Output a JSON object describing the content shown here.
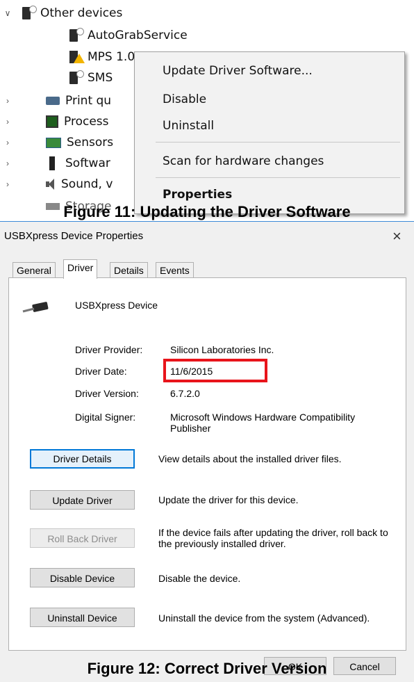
{
  "tree": {
    "rows": [
      {
        "label": "Other devices",
        "expanded": true
      },
      {
        "label": "AutoGrabService"
      },
      {
        "label": "MPS 1.0"
      },
      {
        "label": "SMS"
      },
      {
        "label": "Print qu"
      },
      {
        "label": "Process"
      },
      {
        "label": "Sensors"
      },
      {
        "label": "Softwar"
      },
      {
        "label": "Sound, v"
      },
      {
        "label": "Storage"
      }
    ]
  },
  "context_menu": {
    "items": [
      "Update Driver Software...",
      "Disable",
      "Uninstall",
      "Scan for hardware changes",
      "Properties"
    ]
  },
  "captions": {
    "fig11": "Figure 11: Updating the Driver Software",
    "fig12": "Figure 12: Correct Driver Version"
  },
  "dialog": {
    "title": "USBXpress Device Properties",
    "close": "×",
    "tabs": [
      "General",
      "Driver",
      "Details",
      "Events"
    ],
    "active_tab": "Driver",
    "device_name": "USBXpress Device",
    "fields": [
      {
        "label": "Driver Provider:",
        "value": "Silicon Laboratories Inc."
      },
      {
        "label": "Driver Date:",
        "value": "11/6/2015"
      },
      {
        "label": "Driver Version:",
        "value": "6.7.2.0"
      },
      {
        "label": "Digital Signer:",
        "value": "Microsoft Windows Hardware Compatibility Publisher"
      }
    ],
    "buttons": [
      {
        "label": "Driver Details",
        "desc": "View details about the installed driver files."
      },
      {
        "label": "Update Driver",
        "desc": "Update the driver for this device."
      },
      {
        "label": "Roll Back Driver",
        "desc": "If the device fails after updating the driver, roll back to the previously installed driver."
      },
      {
        "label": "Disable Device",
        "desc": "Disable the device."
      },
      {
        "label": "Uninstall Device",
        "desc": "Uninstall the device from the system (Advanced)."
      }
    ],
    "ok": "OK",
    "cancel": "Cancel",
    "highlight_color": "#e8141b",
    "accent_color": "#0078d7"
  }
}
